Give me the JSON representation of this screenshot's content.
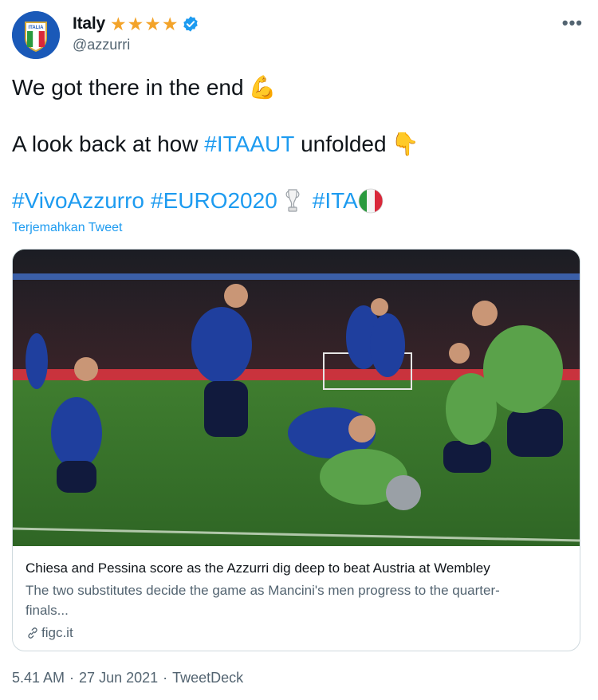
{
  "author": {
    "name": "Italy",
    "handle": "@azzurri",
    "badge_stars": 4,
    "verified": true,
    "avatar_icon": "italy-crest-icon",
    "avatar_text": "ITALIA"
  },
  "more_label": "•••",
  "tweet": {
    "line1": "We got there in the end",
    "line1_emoji": "💪",
    "line2_prefix": "A look back at how ",
    "line2_hashtag": "#ITAAUT",
    "line2_suffix": " unfolded",
    "line2_emoji": "👇",
    "hashtag1": "#VivoAzzurro",
    "hashtag2": "#EURO2020",
    "trophy_icon": "euro-trophy-icon",
    "hashtag3": "#ITA",
    "flag_icon": "italy-flag-icon"
  },
  "translate_label": "Terjemahkan Tweet",
  "card": {
    "image_desc_icon": "match-photo-icon",
    "title": "Chiesa and Pessina score as the Azzurri dig deep to beat Austria at Wembley",
    "description_line1": "The two substitutes decide the game as Mancini's men progress to the quarter-",
    "description_line2": "finals...",
    "domain": "figc.it",
    "link_icon": "link-icon"
  },
  "meta": {
    "time": "5.41 AM",
    "sep1": "·",
    "date": "27 Jun 2021",
    "sep2": "·",
    "source": "TweetDeck"
  },
  "colors": {
    "accent": "#1d9bf0",
    "star": "#f3a329",
    "muted": "#536471"
  }
}
